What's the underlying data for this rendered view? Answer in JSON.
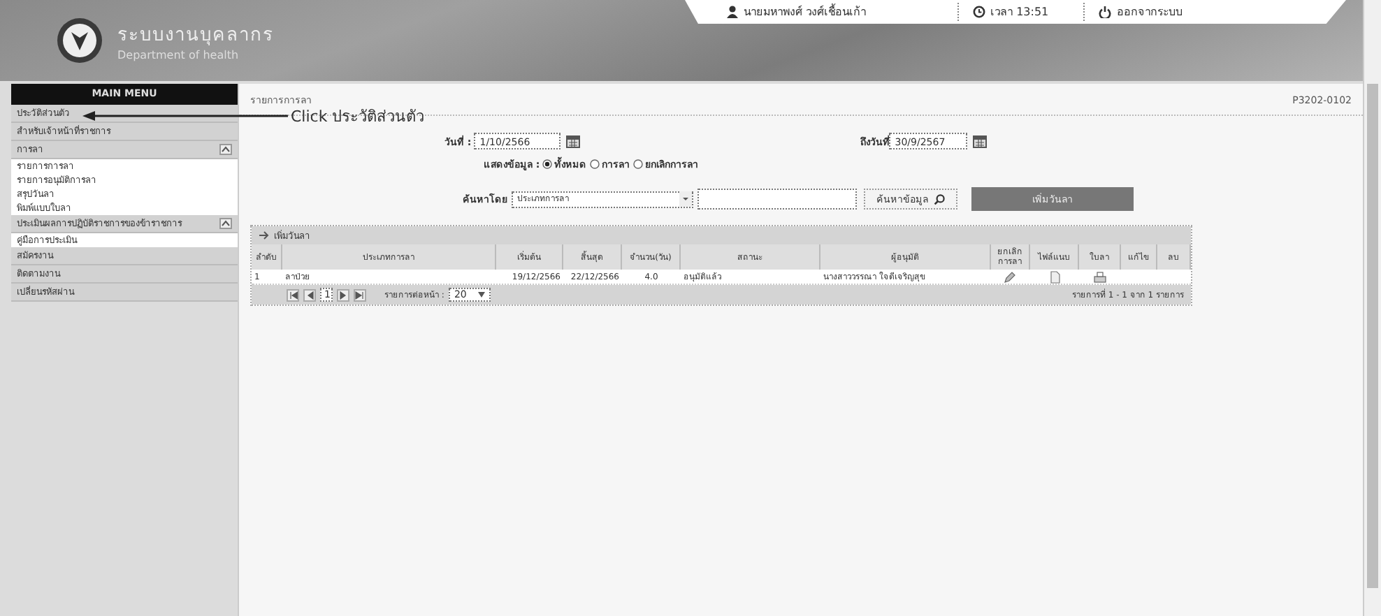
{
  "header": {
    "title": "ระบบงานบุคลากร",
    "subtitle": "Department of health",
    "user": "นายมหาพงศ์ วงศ์เชื้อนเก้า",
    "time": "เวลา 13:51",
    "logout": "ออกจากระบบ"
  },
  "sidebar": {
    "title": "MAIN MENU",
    "items": [
      {
        "kind": "item",
        "label": "ประวัติส่วนตัว"
      },
      {
        "kind": "item",
        "label": "สำหรับเจ้าหน้าที่ราชการ"
      },
      {
        "kind": "group",
        "label": "การลา",
        "expanded": true,
        "children": [
          {
            "label": "รายการการลา"
          },
          {
            "label": "รายการอนุมัติการลา"
          },
          {
            "label": "สรุปวันลา"
          },
          {
            "label": "พิมพ์แบบใบลา"
          }
        ]
      },
      {
        "kind": "group",
        "label": "ประเมินผลการปฏิบัติราชการของข้าราชการ",
        "expanded": true,
        "children": [
          {
            "label": "คู่มือการประเมิน"
          }
        ]
      },
      {
        "kind": "item",
        "label": "สมัครงาน"
      },
      {
        "kind": "item",
        "label": "ติดตามงาน"
      },
      {
        "kind": "item",
        "label": "เปลี่ยนรหัสผ่าน"
      }
    ]
  },
  "annotation": {
    "text": "Click ประวัติส่วนตัว"
  },
  "content": {
    "title": "รายการการลา",
    "code": "P3202-0102",
    "filters": {
      "from_label": "วันที่ :",
      "from_value": "1/10/2566",
      "to_label": "ถึงวันที่",
      "to_value": "30/9/2567",
      "show_label": "แสดงข้อมูล :",
      "options": [
        {
          "label": "ทั้งหมด",
          "selected": true
        },
        {
          "label": "การลา",
          "selected": false
        },
        {
          "label": "ยกเลิกการลา",
          "selected": false
        }
      ],
      "search_label": "ค้นหาโดย",
      "search_by": "ประเภทการลา",
      "search_button": "ค้นหาข้อมูล",
      "add_button": "เพิ่มวันลา"
    },
    "grid": {
      "title": "เพิ่มวันลา",
      "columns": [
        "ลำดับ",
        "ประเภทการลา",
        "เริ่มต้น",
        "สิ้นสุด",
        "จำนวน(วัน)",
        "สถานะ",
        "ผู้อนุมัติ",
        "ยกเลิกการลา",
        "ไฟล์แนบ",
        "ใบลา",
        "แก้ไข",
        "ลบ"
      ],
      "rows": [
        {
          "cells": [
            "1",
            "ลาป่วย",
            "19/12/2566",
            "22/12/2566",
            "4.0",
            "อนุมัติแล้ว",
            "นางสาววรรณา ใจดีเจริญสุข"
          ]
        }
      ],
      "pager": {
        "page": "1",
        "per_page_label": "รายการต่อหน้า :",
        "per_page": "20",
        "summary": "รายการที่ 1 - 1 จาก 1 รายการ"
      }
    }
  }
}
